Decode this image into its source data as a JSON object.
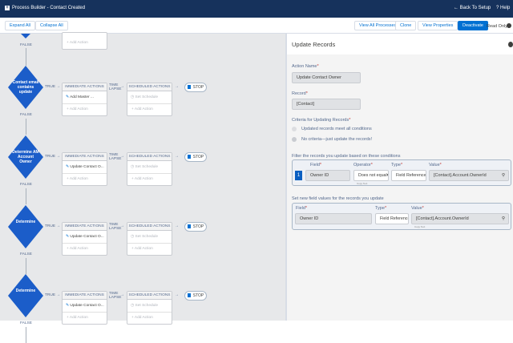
{
  "header": {
    "title": "Process Builder - Contact Created",
    "back": "Back To Setup",
    "help": "Help"
  },
  "toolbar": {
    "expand": "Expand All",
    "collapse": "Collapse All",
    "view_all": "View All Processes",
    "clone": "Clone",
    "view_props": "View Properties",
    "deactivate": "Deactivate",
    "read_only": "Read Only"
  },
  "canvas": {
    "true_label": "TRUE",
    "false_label": "FALSE",
    "time_lapse": "TIME LAPSE",
    "immediate": "IMMEDIATE ACTIONS",
    "scheduled": "SCHEDULED ACTIONS",
    "add_action": "+ Add Action",
    "set_schedule": "Set Schedule",
    "stop": "STOP",
    "nodes": [
      {
        "label": "Contact email contains update",
        "action": "Add Master ..."
      },
      {
        "label": "Determine AM Account Owner",
        "action": "Update Contact O..."
      },
      {
        "label": "Determine",
        "action": "Update Contact O..."
      },
      {
        "label": "Determine",
        "action": "Update Contact O..."
      }
    ]
  },
  "panel": {
    "title": "Update Records",
    "action_name_label": "Action Name",
    "action_name": "Update Contact Owner",
    "record_label": "Record",
    "record": "[Contact]",
    "criteria_label": "Criteria for Updating Records",
    "criteria_opt1": "Updated records meet all conditions",
    "criteria_opt2": "No criteria—just update the records!",
    "filter_label": "Filter the records you update based on these conditions",
    "filter": {
      "index": "1",
      "field_h": "Field",
      "operator_h": "Operator",
      "type_h": "Type",
      "value_h": "Value",
      "field": "Owner ID",
      "operator": "Does not equal",
      "type": "Field Reference",
      "value": "[Contact].Account.OwnerId",
      "copy": "Copy Text"
    },
    "set_label": "Set new field values for the records you update",
    "set": {
      "field_h": "Field",
      "type_h": "Type",
      "value_h": "Value",
      "field": "Owner ID",
      "type": "Field Reference",
      "value": "[Contact].Account.OwnerId",
      "copy": "Copy Text"
    }
  }
}
